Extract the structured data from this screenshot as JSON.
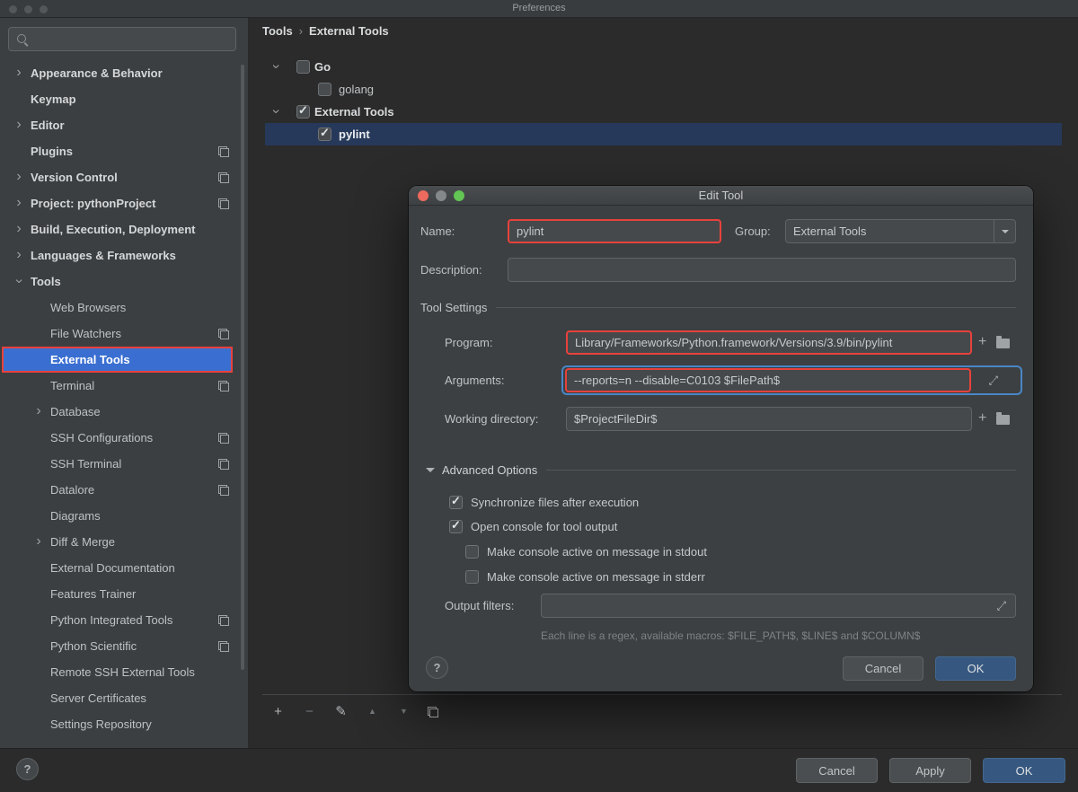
{
  "colors": {
    "annotation_red": "#e8413c",
    "sidebar_selection_blue": "#3a6fd1",
    "tree_selection_blue": "#27395a",
    "primary_button_blue": "#365880",
    "focus_ring_blue": "#4a86c7"
  },
  "window": {
    "title": "Preferences"
  },
  "sidebar": {
    "search_value": "",
    "selected_item": "External Tools",
    "items": [
      {
        "label": "Appearance & Behavior",
        "level": 1,
        "chevron": "right",
        "shared_icon": false,
        "selected": false
      },
      {
        "label": "Keymap",
        "level": 1,
        "chevron": null,
        "shared_icon": false,
        "selected": false
      },
      {
        "label": "Editor",
        "level": 1,
        "chevron": "right",
        "shared_icon": false,
        "selected": false
      },
      {
        "label": "Plugins",
        "level": 1,
        "chevron": null,
        "shared_icon": true,
        "selected": false
      },
      {
        "label": "Version Control",
        "level": 1,
        "chevron": "right",
        "shared_icon": true,
        "selected": false
      },
      {
        "label": "Project: pythonProject",
        "level": 1,
        "chevron": "right",
        "shared_icon": true,
        "selected": false
      },
      {
        "label": "Build, Execution, Deployment",
        "level": 1,
        "chevron": "right",
        "shared_icon": false,
        "selected": false
      },
      {
        "label": "Languages & Frameworks",
        "level": 1,
        "chevron": "right",
        "shared_icon": false,
        "selected": false
      },
      {
        "label": "Tools",
        "level": 1,
        "chevron": "down",
        "shared_icon": false,
        "selected": false
      },
      {
        "label": "Web Browsers",
        "level": 2,
        "chevron": null,
        "shared_icon": false,
        "selected": false
      },
      {
        "label": "File Watchers",
        "level": 2,
        "chevron": null,
        "shared_icon": true,
        "selected": false
      },
      {
        "label": "External Tools",
        "level": 2,
        "chevron": null,
        "shared_icon": false,
        "selected": true
      },
      {
        "label": "Terminal",
        "level": 2,
        "chevron": null,
        "shared_icon": true,
        "selected": false
      },
      {
        "label": "Database",
        "level": 2,
        "chevron": "right",
        "shared_icon": false,
        "selected": false
      },
      {
        "label": "SSH Configurations",
        "level": 2,
        "chevron": null,
        "shared_icon": true,
        "selected": false
      },
      {
        "label": "SSH Terminal",
        "level": 2,
        "chevron": null,
        "shared_icon": true,
        "selected": false
      },
      {
        "label": "Datalore",
        "level": 2,
        "chevron": null,
        "shared_icon": true,
        "selected": false
      },
      {
        "label": "Diagrams",
        "level": 2,
        "chevron": null,
        "shared_icon": false,
        "selected": false
      },
      {
        "label": "Diff & Merge",
        "level": 2,
        "chevron": "right",
        "shared_icon": false,
        "selected": false
      },
      {
        "label": "External Documentation",
        "level": 2,
        "chevron": null,
        "shared_icon": false,
        "selected": false
      },
      {
        "label": "Features Trainer",
        "level": 2,
        "chevron": null,
        "shared_icon": false,
        "selected": false
      },
      {
        "label": "Python Integrated Tools",
        "level": 2,
        "chevron": null,
        "shared_icon": true,
        "selected": false
      },
      {
        "label": "Python Scientific",
        "level": 2,
        "chevron": null,
        "shared_icon": true,
        "selected": false
      },
      {
        "label": "Remote SSH External Tools",
        "level": 2,
        "chevron": null,
        "shared_icon": false,
        "selected": false
      },
      {
        "label": "Server Certificates",
        "level": 2,
        "chevron": null,
        "shared_icon": false,
        "selected": false
      },
      {
        "label": "Settings Repository",
        "level": 2,
        "chevron": null,
        "shared_icon": false,
        "selected": false
      }
    ]
  },
  "breadcrumb": {
    "section": "Tools",
    "separator": "›",
    "page": "External Tools"
  },
  "tools_tree": {
    "rows": [
      {
        "label": "Go",
        "level": 1,
        "checked": false,
        "expanded": true,
        "selected": false
      },
      {
        "label": "golang",
        "level": 2,
        "checked": false,
        "selected": false
      },
      {
        "label": "External Tools",
        "level": 1,
        "checked": true,
        "expanded": true,
        "selected": false
      },
      {
        "label": "pylint",
        "level": 2,
        "checked": true,
        "selected": true
      }
    ],
    "toolbar": {
      "add": "+",
      "remove": "−",
      "edit": "✎",
      "move_up": "▲",
      "move_down": "▼"
    }
  },
  "dialog": {
    "title": "Edit Tool",
    "icons": {
      "insert_macro": "+"
    },
    "fields": {
      "name_label": "Name:",
      "name_value": "pylint",
      "group_label": "Group:",
      "group_value": "External Tools",
      "description_label": "Description:",
      "description_value": ""
    },
    "tool_settings": {
      "header": "Tool Settings",
      "program_label": "Program:",
      "program_value": "Library/Frameworks/Python.framework/Versions/3.9/bin/pylint",
      "arguments_label": "Arguments:",
      "arguments_value": "--reports=n --disable=C0103 $FilePath$",
      "working_directory_label": "Working directory:",
      "working_directory_value": "$ProjectFileDir$"
    },
    "advanced_options": {
      "header": "Advanced Options",
      "checkboxes": [
        {
          "label": "Synchronize files after execution",
          "checked": true
        },
        {
          "label": "Open console for tool output",
          "checked": true
        },
        {
          "label": "Make console active on message in stdout",
          "checked": false
        },
        {
          "label": "Make console active on message in stderr",
          "checked": false
        }
      ],
      "output_filters_label": "Output filters:",
      "output_filters_value": "",
      "hint": "Each line is a regex, available macros: $FILE_PATH$, $LINE$ and $COLUMN$"
    },
    "buttons": {
      "help": "?",
      "cancel": "Cancel",
      "ok": "OK"
    }
  },
  "footer": {
    "help": "?",
    "cancel": "Cancel",
    "apply": "Apply",
    "ok": "OK"
  }
}
